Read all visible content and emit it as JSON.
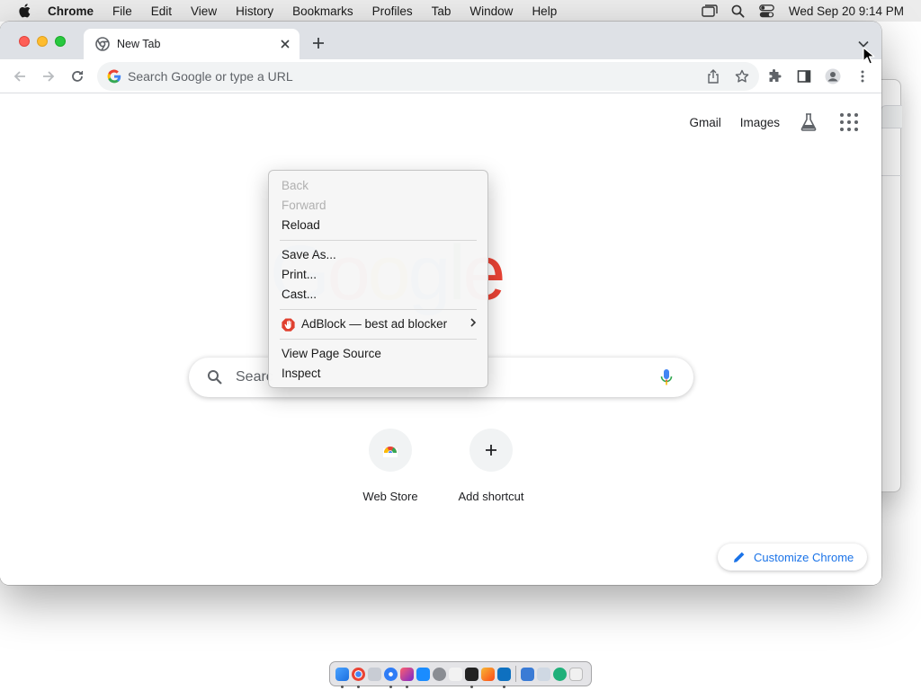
{
  "menubar": {
    "app_name": "Chrome",
    "items": [
      "File",
      "Edit",
      "View",
      "History",
      "Bookmarks",
      "Profiles",
      "Tab",
      "Window",
      "Help"
    ],
    "clock": "Wed Sep 20  9:14 PM"
  },
  "browser": {
    "tab_title": "New Tab",
    "omnibox_placeholder": "Search Google or type a URL"
  },
  "ntp": {
    "top_links": {
      "gmail": "Gmail",
      "images": "Images"
    },
    "logo_visible": "gle",
    "search_placeholder": "Searc",
    "shortcuts": [
      {
        "label": "Web Store",
        "icon": "web-store-icon"
      },
      {
        "label": "Add shortcut",
        "icon": "plus-icon"
      }
    ],
    "customize_label": "Customize Chrome"
  },
  "context_menu": {
    "groups": [
      [
        {
          "label": "Back",
          "enabled": false
        },
        {
          "label": "Forward",
          "enabled": false
        },
        {
          "label": "Reload",
          "enabled": true
        }
      ],
      [
        {
          "label": "Save As...",
          "enabled": true
        },
        {
          "label": "Print...",
          "enabled": true
        },
        {
          "label": "Cast...",
          "enabled": true
        }
      ],
      [
        {
          "label": "AdBlock — best ad blocker",
          "enabled": true,
          "submenu": true,
          "icon": "adblock-icon"
        }
      ],
      [
        {
          "label": "View Page Source",
          "enabled": true
        },
        {
          "label": "Inspect",
          "enabled": true
        }
      ]
    ]
  },
  "colors": {
    "google_blue": "#4285f4",
    "google_red": "#ea4335",
    "google_yellow": "#fbbc05",
    "google_green": "#34a853",
    "link_blue": "#1a73e8",
    "adblock_red": "#e0402f"
  }
}
